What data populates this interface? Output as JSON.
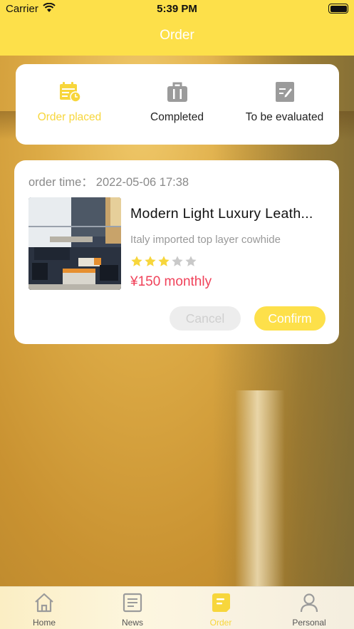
{
  "status_bar": {
    "carrier": "Carrier",
    "time": "5:39 PM"
  },
  "header": {
    "title": "Order"
  },
  "order_status": {
    "active_color": "#f7d63c",
    "items": [
      {
        "label": "Order placed",
        "icon": "calendar-clock-icon",
        "active": true
      },
      {
        "label": "Completed",
        "icon": "suitcase-icon",
        "active": false
      },
      {
        "label": "To be evaluated",
        "icon": "edit-note-icon",
        "active": false
      }
    ]
  },
  "order": {
    "time_label": "order time：",
    "time_value": "2022-05-06 17:38",
    "product_name": "Modern Light Luxury Leath...",
    "product_desc": "Italy imported top layer cowhide",
    "rating": 3,
    "rating_max": 5,
    "price": "¥150 monthly",
    "cancel_label": "Cancel",
    "confirm_label": "Confirm"
  },
  "tabbar": {
    "items": [
      {
        "label": "Home",
        "icon": "home-icon",
        "active": false
      },
      {
        "label": "News",
        "icon": "news-icon",
        "active": false
      },
      {
        "label": "Order",
        "icon": "order-icon",
        "active": true
      },
      {
        "label": "Personal",
        "icon": "person-icon",
        "active": false
      }
    ]
  },
  "colors": {
    "brand_yellow": "#fde04a",
    "price_red": "#f0425a"
  }
}
